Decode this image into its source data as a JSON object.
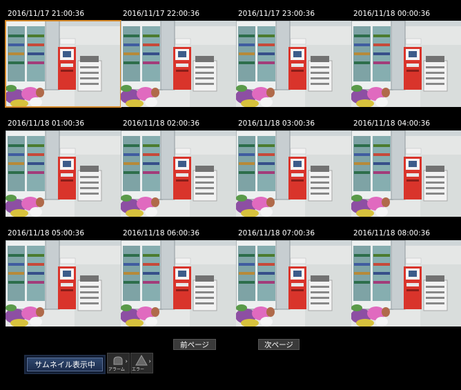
{
  "thumbnails": [
    "2016/11/17 21:00:36",
    "2016/11/17 22:00:36",
    "2016/11/17 23:00:36",
    "2016/11/18 00:00:36",
    "2016/11/18 01:00:36",
    "2016/11/18 02:00:36",
    "2016/11/18 03:00:36",
    "2016/11/18 04:00:36",
    "2016/11/18 05:00:36",
    "2016/11/18 06:00:36",
    "2016/11/18 07:00:36",
    "2016/11/18 08:00:36"
  ],
  "selected_index": 0,
  "nav": {
    "prev_label": "前ページ",
    "next_label": "次ページ"
  },
  "mode_label": "サムネイル表示中",
  "alarm": {
    "icon": "alarm-bell-icon",
    "label": "アラーム"
  },
  "error": {
    "icon": "warning-triangle-icon",
    "label": "エラー"
  },
  "colors": {
    "selection": "#d68a2a",
    "background": "#000000"
  }
}
